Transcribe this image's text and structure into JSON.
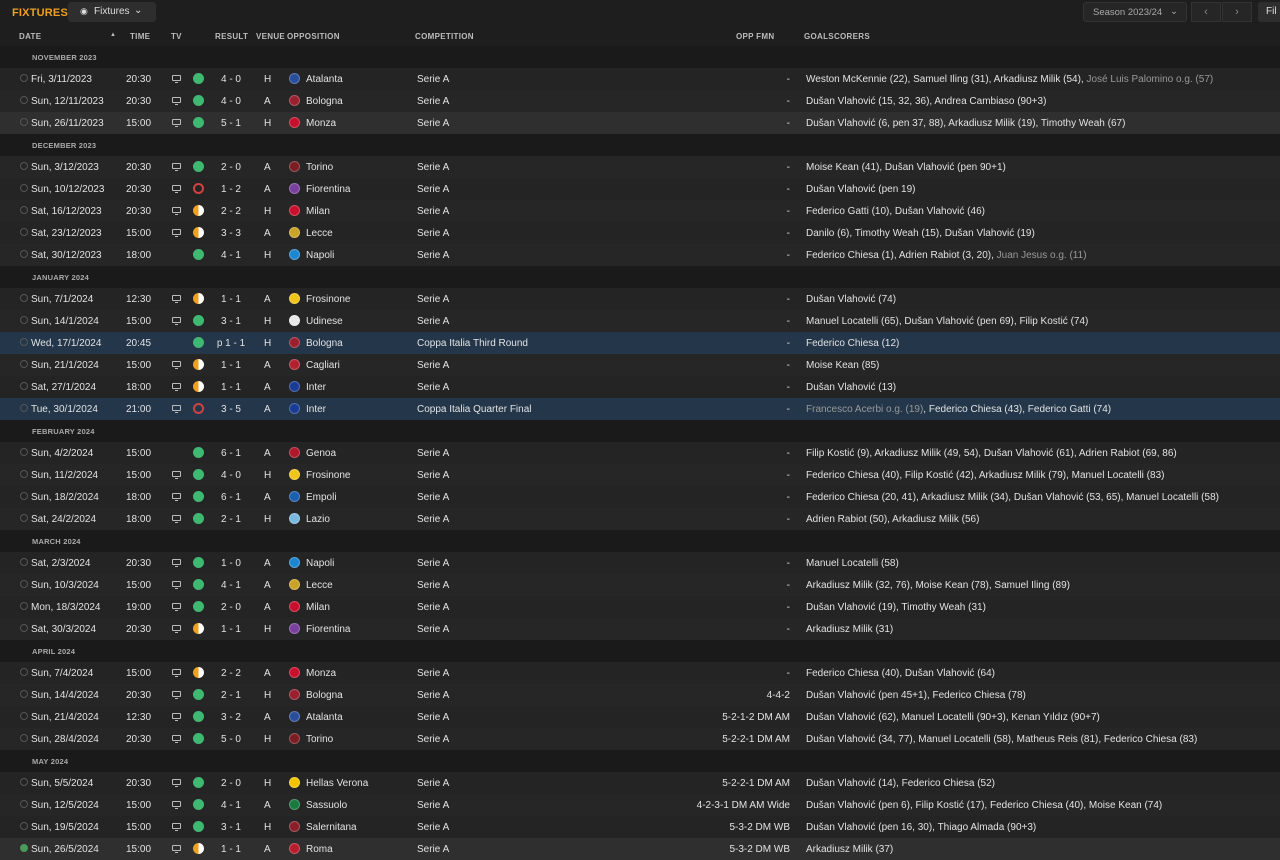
{
  "header": {
    "title": "FIXTURES",
    "view_label": "Fixtures",
    "season_label": "Season 2023/24",
    "filter_label": "Fil"
  },
  "columns": {
    "date": "DATE",
    "time": "TIME",
    "tv": "TV",
    "result": "RESULT",
    "venue": "VENUE",
    "opposition": "OPPOSITION",
    "competition": "COMPETITION",
    "opp_fmn": "OPP FMN",
    "goalscorers": "GOALSCORERS"
  },
  "badge_colors": {
    "Atalanta": "#2a4f9a",
    "Bologna": "#9a1f2f",
    "Monza": "#c8102e",
    "Torino": "#7a1e24",
    "Fiorentina": "#7b3fa0",
    "Milan": "#c8102e",
    "Lecce": "#c9a227",
    "Napoli": "#1d86d1",
    "Frosinone": "#f0c419",
    "Udinese": "#e8e8e8",
    "Cagliari": "#b5202f",
    "Inter": "#1a3c96",
    "Genoa": "#b0172a",
    "Empoli": "#1b5fb0",
    "Lazio": "#7ab8e0",
    "Hellas Verona": "#f2c500",
    "Sassuolo": "#1a7a3e",
    "Salernitana": "#8a1f2a",
    "Roma": "#b61e2e"
  },
  "months": [
    {
      "label": "NOVEMBER 2023",
      "fixtures": [
        {
          "date": "Fri, 3/11/2023",
          "time": "20:30",
          "tv": true,
          "outcome": "win",
          "score": "4 - 0",
          "venue": "H",
          "opp": "Atalanta",
          "comp": "Serie A",
          "fmn": "-",
          "goals": "Weston McKennie (22), Samuel Iling (31), Arkadiusz Milik (54), ",
          "og": "José Luis Palomino o.g. (57)",
          "goals_after": ""
        },
        {
          "date": "Sun, 12/11/2023",
          "time": "20:30",
          "tv": true,
          "outcome": "win",
          "score": "4 - 0",
          "venue": "A",
          "opp": "Bologna",
          "comp": "Serie A",
          "fmn": "-",
          "goals": "Dušan Vlahović (15, 32, 36), Andrea Cambiaso (90+3)"
        },
        {
          "date": "Sun, 26/11/2023",
          "time": "15:00",
          "tv": true,
          "outcome": "win",
          "score": "5 - 1",
          "venue": "H",
          "opp": "Monza",
          "comp": "Serie A",
          "fmn": "-",
          "goals": "Dušan Vlahović (6, pen 37, 88), Arkadiusz Milik (19), Timothy Weah (67)",
          "highlight": true
        }
      ]
    },
    {
      "label": "DECEMBER 2023",
      "fixtures": [
        {
          "date": "Sun, 3/12/2023",
          "time": "20:30",
          "tv": true,
          "outcome": "win",
          "score": "2 - 0",
          "venue": "A",
          "opp": "Torino",
          "comp": "Serie A",
          "fmn": "-",
          "goals": "Moise Kean (41), Dušan Vlahović (pen 90+1)"
        },
        {
          "date": "Sun, 10/12/2023",
          "time": "20:30",
          "tv": true,
          "outcome": "loss",
          "score": "1 - 2",
          "venue": "A",
          "opp": "Fiorentina",
          "comp": "Serie A",
          "fmn": "-",
          "goals": "Dušan Vlahović (pen 19)"
        },
        {
          "date": "Sat, 16/12/2023",
          "time": "20:30",
          "tv": true,
          "outcome": "draw",
          "score": "2 - 2",
          "venue": "H",
          "opp": "Milan",
          "comp": "Serie A",
          "fmn": "-",
          "goals": "Federico Gatti (10), Dušan Vlahović (46)"
        },
        {
          "date": "Sat, 23/12/2023",
          "time": "15:00",
          "tv": true,
          "outcome": "draw",
          "score": "3 - 3",
          "venue": "A",
          "opp": "Lecce",
          "comp": "Serie A",
          "fmn": "-",
          "goals": "Danilo (6), Timothy Weah (15), Dušan Vlahović (19)"
        },
        {
          "date": "Sat, 30/12/2023",
          "time": "18:00",
          "tv": false,
          "outcome": "win",
          "score": "4 - 1",
          "venue": "H",
          "opp": "Napoli",
          "comp": "Serie A",
          "fmn": "-",
          "goals": "Federico Chiesa (1), Adrien Rabiot (3, 20), ",
          "og": "Juan Jesus o.g. (11)",
          "goals_after": ""
        }
      ]
    },
    {
      "label": "JANUARY 2024",
      "fixtures": [
        {
          "date": "Sun, 7/1/2024",
          "time": "12:30",
          "tv": true,
          "outcome": "draw",
          "score": "1 - 1",
          "venue": "A",
          "opp": "Frosinone",
          "comp": "Serie A",
          "fmn": "-",
          "goals": "Dušan Vlahović (74)"
        },
        {
          "date": "Sun, 14/1/2024",
          "time": "15:00",
          "tv": true,
          "outcome": "win",
          "score": "3 - 1",
          "venue": "H",
          "opp": "Udinese",
          "comp": "Serie A",
          "fmn": "-",
          "goals": "Manuel Locatelli (65), Dušan Vlahović (pen 69), Filip Kostić (74)"
        },
        {
          "date": "Wed, 17/1/2024",
          "time": "20:45",
          "tv": false,
          "outcome": "win",
          "score": "p 1 - 1",
          "venue": "H",
          "opp": "Bologna",
          "comp": "Coppa Italia Third Round",
          "fmn": "-",
          "goals": "Federico Chiesa (12)",
          "cup": true
        },
        {
          "date": "Sun, 21/1/2024",
          "time": "15:00",
          "tv": true,
          "outcome": "draw",
          "score": "1 - 1",
          "venue": "A",
          "opp": "Cagliari",
          "comp": "Serie A",
          "fmn": "-",
          "goals": "Moise Kean (85)"
        },
        {
          "date": "Sat, 27/1/2024",
          "time": "18:00",
          "tv": true,
          "outcome": "draw",
          "score": "1 - 1",
          "venue": "A",
          "opp": "Inter",
          "comp": "Serie A",
          "fmn": "-",
          "goals": "Dušan Vlahović (13)"
        },
        {
          "date": "Tue, 30/1/2024",
          "time": "21:00",
          "tv": true,
          "outcome": "loss",
          "score": "3 - 5",
          "venue": "A",
          "opp": "Inter",
          "comp": "Coppa Italia Quarter Final",
          "fmn": "-",
          "goals": "",
          "og": "Francesco Acerbi o.g. (19)",
          "goals_after": ", Federico Chiesa (43), Federico Gatti (74)",
          "cup": true
        }
      ]
    },
    {
      "label": "FEBRUARY 2024",
      "fixtures": [
        {
          "date": "Sun, 4/2/2024",
          "time": "15:00",
          "tv": false,
          "outcome": "win",
          "score": "6 - 1",
          "venue": "A",
          "opp": "Genoa",
          "comp": "Serie A",
          "fmn": "-",
          "goals": "Filip Kostić (9), Arkadiusz Milik (49, 54), Dušan Vlahović (61), Adrien Rabiot (69, 86)"
        },
        {
          "date": "Sun, 11/2/2024",
          "time": "15:00",
          "tv": true,
          "outcome": "win",
          "score": "4 - 0",
          "venue": "H",
          "opp": "Frosinone",
          "comp": "Serie A",
          "fmn": "-",
          "goals": "Federico Chiesa (40), Filip Kostić (42), Arkadiusz Milik (79), Manuel Locatelli (83)"
        },
        {
          "date": "Sun, 18/2/2024",
          "time": "18:00",
          "tv": true,
          "outcome": "win",
          "score": "6 - 1",
          "venue": "A",
          "opp": "Empoli",
          "comp": "Serie A",
          "fmn": "-",
          "goals": "Federico Chiesa (20, 41), Arkadiusz Milik (34), Dušan Vlahović (53, 65), Manuel Locatelli (58)"
        },
        {
          "date": "Sat, 24/2/2024",
          "time": "18:00",
          "tv": true,
          "outcome": "win",
          "score": "2 - 1",
          "venue": "H",
          "opp": "Lazio",
          "comp": "Serie A",
          "fmn": "-",
          "goals": "Adrien Rabiot (50), Arkadiusz Milik (56)"
        }
      ]
    },
    {
      "label": "MARCH 2024",
      "fixtures": [
        {
          "date": "Sat, 2/3/2024",
          "time": "20:30",
          "tv": true,
          "outcome": "win",
          "score": "1 - 0",
          "venue": "A",
          "opp": "Napoli",
          "comp": "Serie A",
          "fmn": "-",
          "goals": "Manuel Locatelli (58)"
        },
        {
          "date": "Sun, 10/3/2024",
          "time": "15:00",
          "tv": true,
          "outcome": "win",
          "score": "4 - 1",
          "venue": "A",
          "opp": "Lecce",
          "comp": "Serie A",
          "fmn": "-",
          "goals": "Arkadiusz Milik (32, 76), Moise Kean (78), Samuel Iling (89)"
        },
        {
          "date": "Mon, 18/3/2024",
          "time": "19:00",
          "tv": true,
          "outcome": "win",
          "score": "2 - 0",
          "venue": "A",
          "opp": "Milan",
          "comp": "Serie A",
          "fmn": "-",
          "goals": "Dušan Vlahović (19), Timothy Weah (31)"
        },
        {
          "date": "Sat, 30/3/2024",
          "time": "20:30",
          "tv": true,
          "outcome": "draw",
          "score": "1 - 1",
          "venue": "H",
          "opp": "Fiorentina",
          "comp": "Serie A",
          "fmn": "-",
          "goals": "Arkadiusz Milik (31)"
        }
      ]
    },
    {
      "label": "APRIL 2024",
      "fixtures": [
        {
          "date": "Sun, 7/4/2024",
          "time": "15:00",
          "tv": true,
          "outcome": "draw",
          "score": "2 - 2",
          "venue": "A",
          "opp": "Monza",
          "comp": "Serie A",
          "fmn": "-",
          "goals": "Federico Chiesa (40), Dušan Vlahović (64)"
        },
        {
          "date": "Sun, 14/4/2024",
          "time": "20:30",
          "tv": true,
          "outcome": "win",
          "score": "2 - 1",
          "venue": "H",
          "opp": "Bologna",
          "comp": "Serie A",
          "fmn": "4-4-2",
          "goals": "Dušan Vlahović (pen 45+1), Federico Chiesa (78)"
        },
        {
          "date": "Sun, 21/4/2024",
          "time": "12:30",
          "tv": true,
          "outcome": "win",
          "score": "3 - 2",
          "venue": "A",
          "opp": "Atalanta",
          "comp": "Serie A",
          "fmn": "5-2-1-2 DM AM",
          "goals": "Dušan Vlahović (62), Manuel Locatelli (90+3), Kenan Yıldız (90+7)"
        },
        {
          "date": "Sun, 28/4/2024",
          "time": "20:30",
          "tv": true,
          "outcome": "win",
          "score": "5 - 0",
          "venue": "H",
          "opp": "Torino",
          "comp": "Serie A",
          "fmn": "5-2-2-1 DM AM",
          "goals": "Dušan Vlahović (34, 77), Manuel Locatelli (58), Matheus Reis (81), Federico Chiesa (83)"
        }
      ]
    },
    {
      "label": "MAY 2024",
      "fixtures": [
        {
          "date": "Sun, 5/5/2024",
          "time": "20:30",
          "tv": true,
          "outcome": "win",
          "score": "2 - 0",
          "venue": "H",
          "opp": "Hellas Verona",
          "comp": "Serie A",
          "fmn": "5-2-2-1 DM AM",
          "goals": "Dušan Vlahović (14), Federico Chiesa (52)"
        },
        {
          "date": "Sun, 12/5/2024",
          "time": "15:00",
          "tv": true,
          "outcome": "win",
          "score": "4 - 1",
          "venue": "A",
          "opp": "Sassuolo",
          "comp": "Serie A",
          "fmn": "4-2-3-1 DM AM Wide",
          "goals": "Dušan Vlahović (pen 6), Filip Kostić (17), Federico Chiesa (40), Moise Kean (74)"
        },
        {
          "date": "Sun, 19/5/2024",
          "time": "15:00",
          "tv": true,
          "outcome": "win",
          "score": "3 - 1",
          "venue": "H",
          "opp": "Salernitana",
          "comp": "Serie A",
          "fmn": "5-3-2 DM WB",
          "goals": "Dušan Vlahović (pen 16, 30), Thiago Almada (90+3)"
        },
        {
          "date": "Sun, 26/5/2024",
          "time": "15:00",
          "tv": true,
          "outcome": "draw",
          "score": "1 - 1",
          "venue": "A",
          "opp": "Roma",
          "comp": "Serie A",
          "fmn": "5-3-2 DM WB",
          "goals": "Arkadiusz Milik (37)",
          "highlight": true,
          "done": true
        }
      ]
    }
  ]
}
